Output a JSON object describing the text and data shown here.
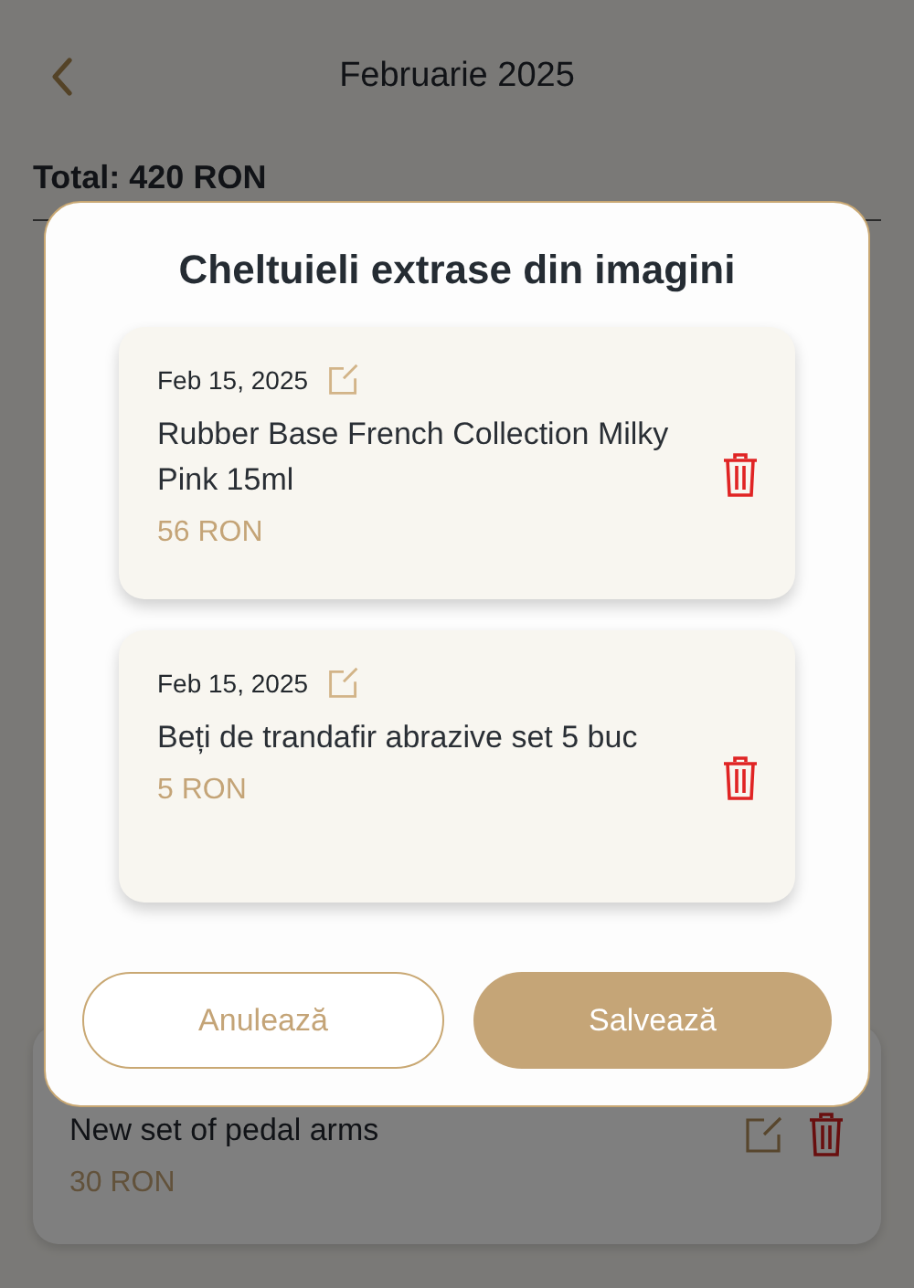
{
  "header": {
    "title": "Februarie 2025"
  },
  "total": "Total: 420 RON",
  "expenses": [
    {
      "title": "New set of pedal arms",
      "amount": "30 RON"
    }
  ],
  "dialog": {
    "title": "Cheltuieli extrase din imagini",
    "items": [
      {
        "date": "Feb 15, 2025",
        "title": "Rubber Base French Collection Milky Pink 15ml",
        "amount": "56 RON"
      },
      {
        "date": "Feb 15, 2025",
        "title": "Beți de trandafir abrazive set 5 buc",
        "amount": "5 RON"
      }
    ],
    "buttons": [
      {
        "label": "Anulează",
        "kind": "outline"
      },
      {
        "label": "Salvează",
        "kind": "filled"
      }
    ]
  }
}
